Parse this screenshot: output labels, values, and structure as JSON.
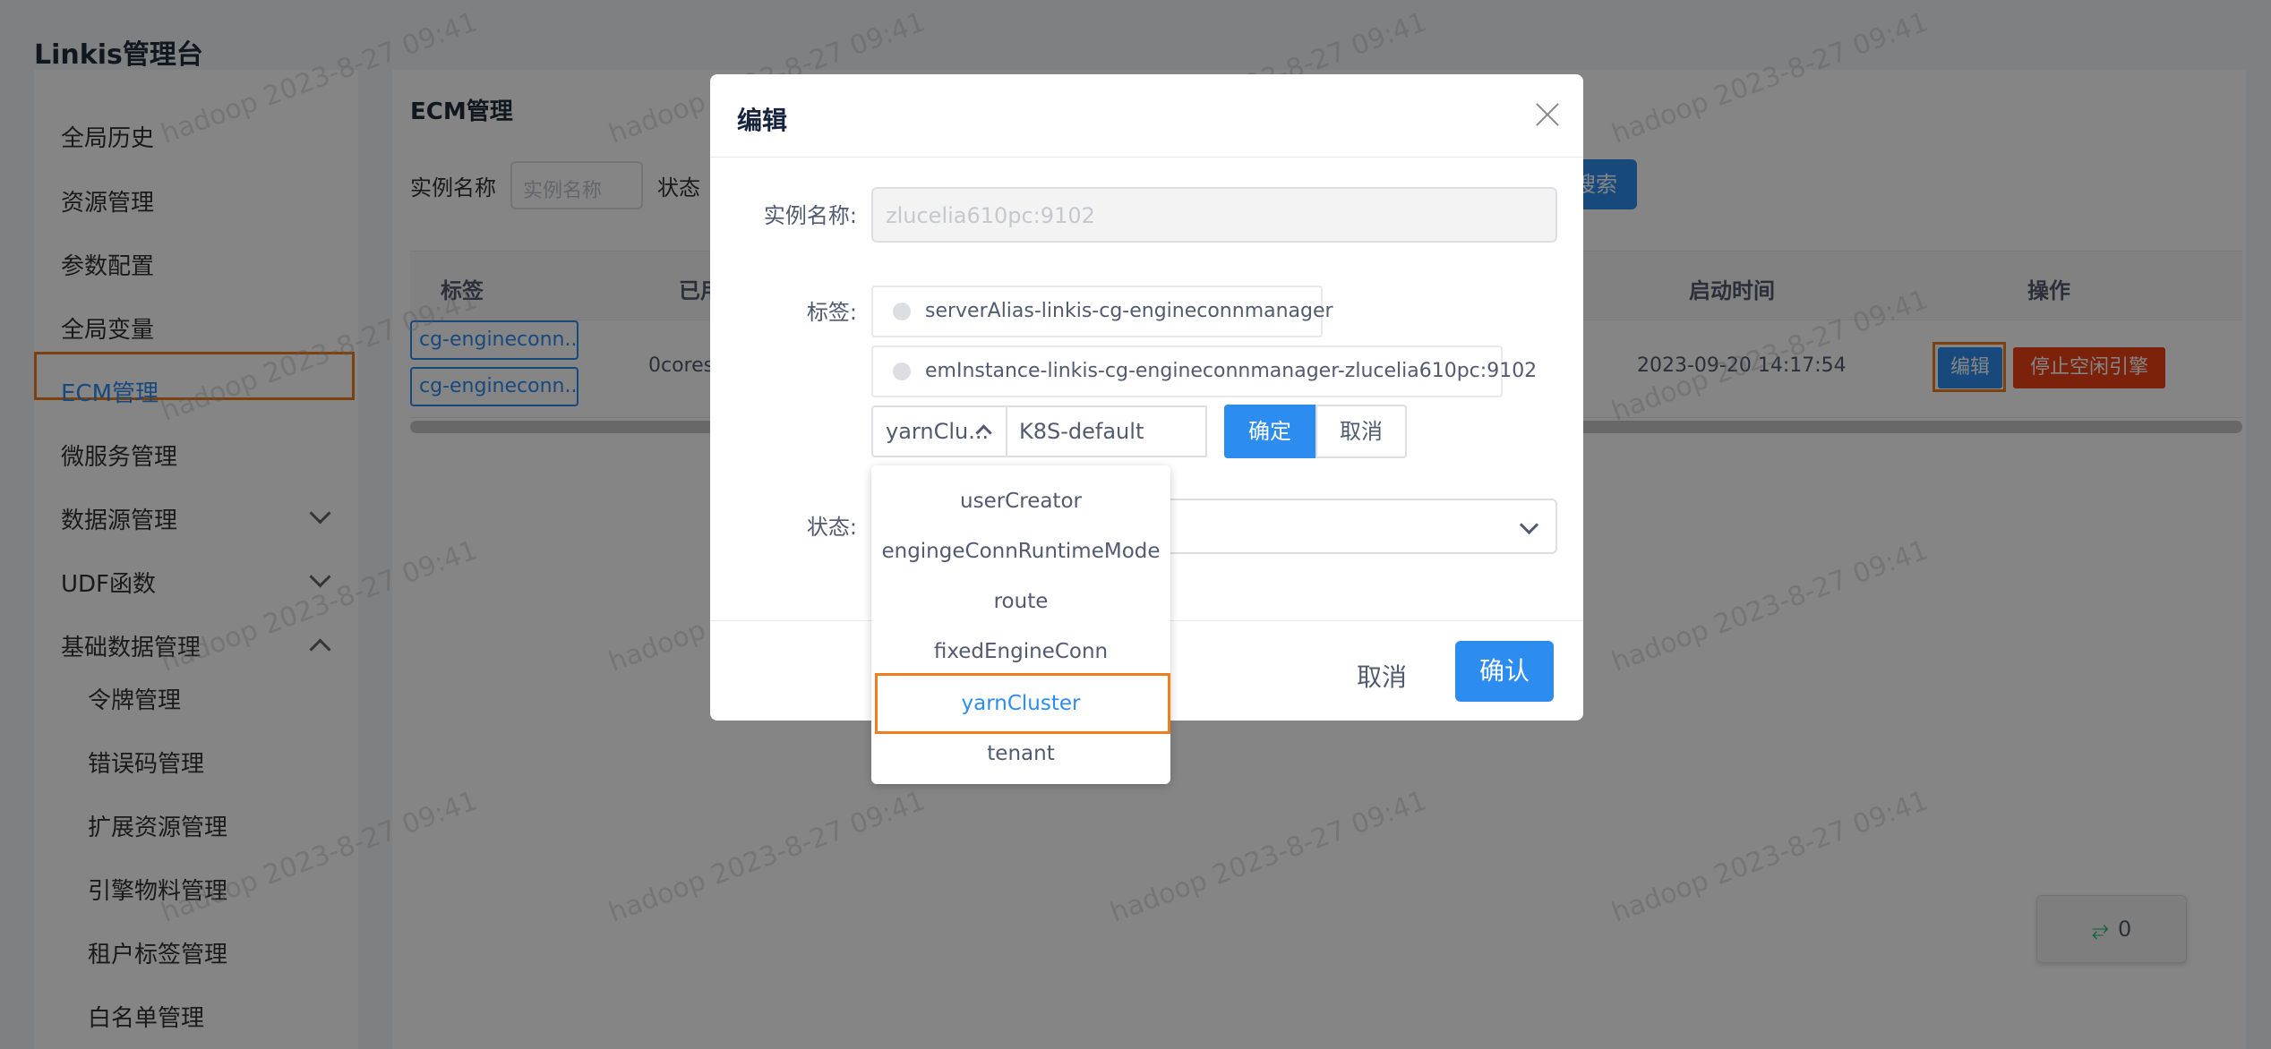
{
  "app": {
    "title": "Linkis管理台"
  },
  "sidebar": {
    "items": [
      {
        "label": "全局历史"
      },
      {
        "label": "资源管理"
      },
      {
        "label": "参数配置"
      },
      {
        "label": "全局变量"
      },
      {
        "label": "ECM管理"
      },
      {
        "label": "微服务管理"
      },
      {
        "label": "数据源管理"
      },
      {
        "label": "UDF函数"
      },
      {
        "label": "基础数据管理"
      }
    ],
    "subitems": [
      {
        "label": "令牌管理"
      },
      {
        "label": "错误码管理"
      },
      {
        "label": "扩展资源管理"
      },
      {
        "label": "引擎物料管理"
      },
      {
        "label": "租户标签管理"
      },
      {
        "label": "白名单管理"
      }
    ]
  },
  "page": {
    "title": "ECM管理",
    "filter_instance_label": "实例名称",
    "filter_instance_placeholder": "实例名称",
    "filter_status_label": "状态",
    "search_label": "搜索"
  },
  "table": {
    "headers": {
      "tags": "标签",
      "used": "已用",
      "start_time": "启动时间",
      "actions": "操作"
    },
    "row": {
      "tag1": "cg-engineconn...",
      "tag2": "cg-engineconn...",
      "used": "0cores,",
      "start_time": "2023-09-20 14:17:54",
      "edit_label": "编辑",
      "stop_label": "停止空闲引擎"
    }
  },
  "modal": {
    "title": "编辑",
    "instance_label": "实例名称:",
    "instance_value": "zlucelia610pc:9102",
    "tags_label": "标签:",
    "tags": [
      "serverAlias-linkis-cg-engineconnmanager",
      "emInstance-linkis-cg-engineconnmanager-zlucelia610pc:9102"
    ],
    "new_tag_key": "yarnClu...",
    "new_tag_value": "K8S-default",
    "confirm_small": "确定",
    "cancel_small": "取消",
    "status_label": "状态:",
    "cancel_label": "取消",
    "ok_label": "确认"
  },
  "dropdown": {
    "options": [
      "userCreator",
      "engingeConnRuntimeMode",
      "route",
      "fixedEngineConn",
      "yarnCluster",
      "tenant"
    ],
    "selected": "yarnCluster"
  },
  "watermark": {
    "text": "hadoop 2023-8-27 09:41"
  },
  "float_counter": {
    "icon": "swap-icon",
    "count": "0"
  },
  "colors": {
    "primary": "#2d8cf0",
    "danger": "#ed4014",
    "highlight": "#f07d1f"
  }
}
